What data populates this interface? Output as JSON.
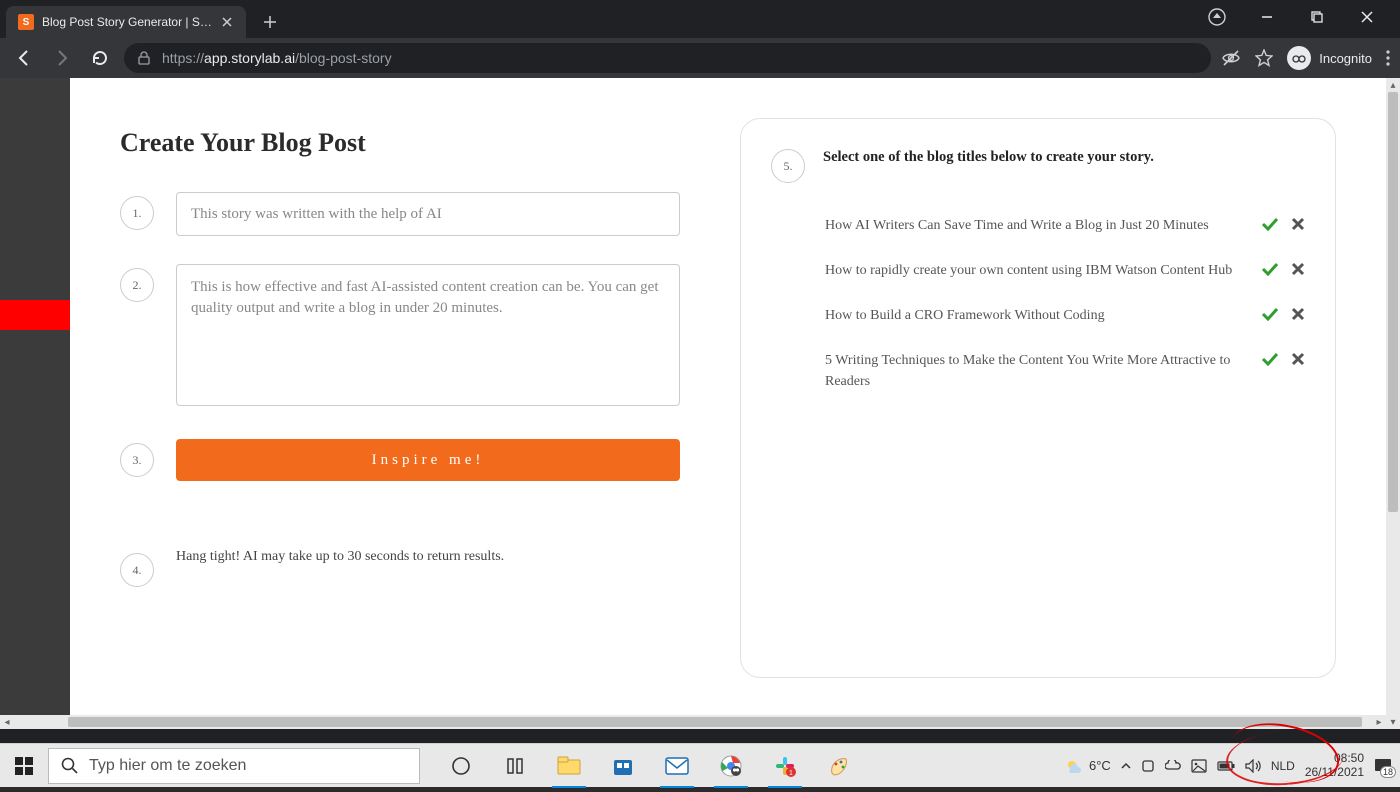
{
  "browser": {
    "tab_title": "Blog Post Story Generator | Story",
    "tab_favicon_letter": "S",
    "url_protocol": "https://",
    "url_host": "app.storylab.ai",
    "url_path": "/blog-post-story",
    "incognito_label": "Incognito"
  },
  "page": {
    "title": "Create Your Blog Post",
    "steps": {
      "1": "1.",
      "2": "2.",
      "3": "3.",
      "4": "4.",
      "5": "5."
    },
    "title_input_value": "This story was written with the help of AI",
    "description_input_value": "This is how effective and fast AI-assisted content creation can be. You can get quality output and write a blog in under 20 minutes.",
    "inspire_button": "Inspire me!",
    "hang_tight": "Hang tight! AI may take up to 30 seconds to return results.",
    "step5_label": "Select one of the blog titles below to create your story.",
    "suggestions": [
      " How AI Writers Can Save Time and Write a Blog in Just 20 Minutes",
      " How to rapidly create your own content using IBM Watson Content Hub",
      " How to Build a CRO Framework Without Coding",
      " 5 Writing Techniques to Make the Content You Write More Attractive to Readers"
    ]
  },
  "taskbar": {
    "search_placeholder": "Typ hier om te zoeken",
    "weather_temp": "6°C",
    "lang": "NLD",
    "time": "08:50",
    "date": "26/11/2021",
    "notif_count": "18"
  }
}
